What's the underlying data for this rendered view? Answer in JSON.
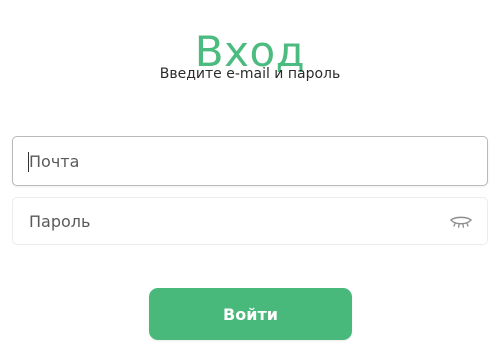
{
  "login": {
    "title": "Вход",
    "subtitle": "Введите e-mail и пароль",
    "email_field": {
      "placeholder": "Почта",
      "value": ""
    },
    "password_field": {
      "placeholder": "Пароль",
      "value": "",
      "toggle_icon": "eye-closed-icon"
    },
    "submit_label": "Войти"
  },
  "colors": {
    "accent": "#48b97b",
    "title": "#4cbb7f",
    "text": "#2b2b2b",
    "placeholder": "#5a5a5a",
    "border": "#ececec",
    "border_focus": "#b9b9b9"
  }
}
